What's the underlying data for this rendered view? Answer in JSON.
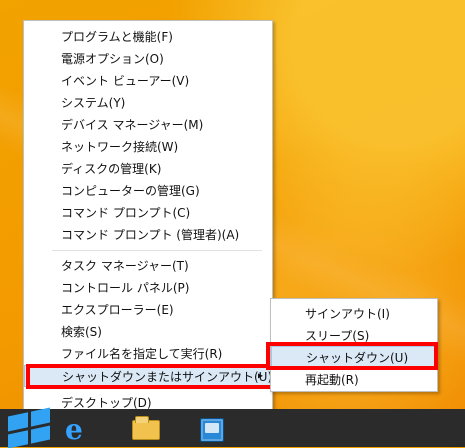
{
  "desktop": {
    "colors": {
      "accent_red": "#ff0000",
      "menu_border": "#bfbfbf",
      "hover_blue": "#dbe9f7"
    }
  },
  "main_menu": {
    "items": [
      "プログラムと機能(F)",
      "電源オプション(O)",
      "イベント ビューアー(V)",
      "システム(Y)",
      "デバイス マネージャー(M)",
      "ネットワーク接続(W)",
      "ディスクの管理(K)",
      "コンピューターの管理(G)",
      "コマンド プロンプト(C)",
      "コマンド プロンプト (管理者)(A)",
      "タスク マネージャー(T)",
      "コントロール パネル(P)",
      "エクスプローラー(E)",
      "検索(S)",
      "ファイル名を指定して実行(R)",
      "シャットダウンまたはサインアウト(U)",
      "デスクトップ(D)"
    ],
    "submenu_arrow": "▸"
  },
  "submenu": {
    "items": [
      "サインアウト(I)",
      "スリープ(S)",
      "シャットダウン(U)",
      "再起動(R)"
    ]
  },
  "taskbar": {
    "icons": [
      "windows-start-icon",
      "internet-explorer-icon",
      "file-explorer-icon",
      "control-panel-icon"
    ],
    "ie_glyph": "e"
  }
}
